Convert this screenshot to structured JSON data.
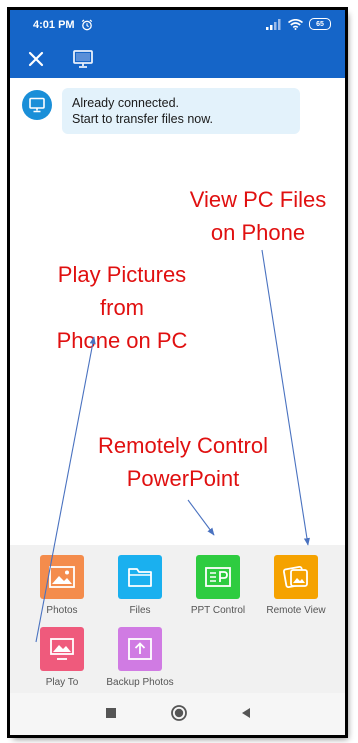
{
  "status": {
    "time": "4:01 PM",
    "battery": "65"
  },
  "message": {
    "line1": "Already connected.",
    "line2": "Start to transfer files now."
  },
  "annotations": {
    "view_pc_files": [
      "View PC Files",
      "on Phone"
    ],
    "play_pictures": [
      "Play Pictures",
      "from",
      "Phone on PC"
    ],
    "remote_ppt": [
      "Remotely Control",
      "PowerPoint"
    ]
  },
  "features": [
    {
      "label": "Photos",
      "color": "#f48c4c",
      "icon": "photo-icon"
    },
    {
      "label": "Files",
      "color": "#1ab0ef",
      "icon": "folder-icon"
    },
    {
      "label": "PPT Control",
      "color": "#2ecc40",
      "icon": "presentation-icon"
    },
    {
      "label": "Remote View",
      "color": "#f5a200",
      "icon": "remote-view-icon"
    },
    {
      "label": "Play To",
      "color": "#ef5a7c",
      "icon": "cast-picture-icon"
    },
    {
      "label": "Backup Photos",
      "color": "#d07be3",
      "icon": "upload-icon"
    }
  ],
  "colors": {
    "header": "#1565c8",
    "annotation_text": "#e01010",
    "arrow": "#4a72c0"
  }
}
